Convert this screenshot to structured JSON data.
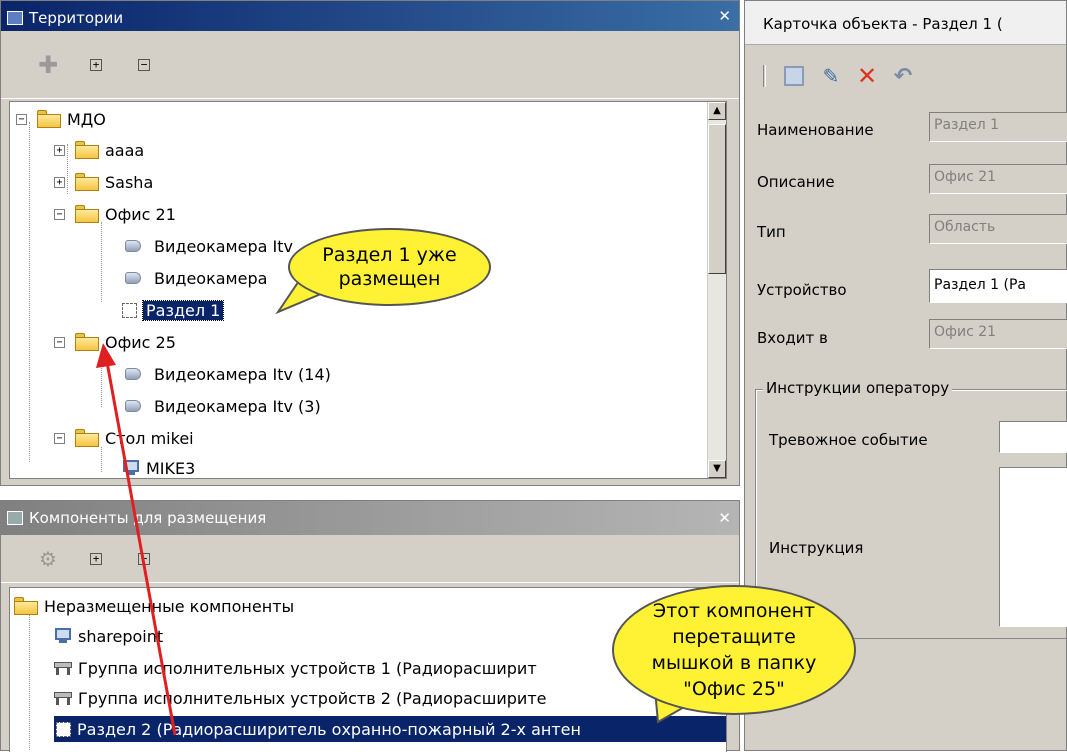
{
  "territories": {
    "title": "Территории",
    "tree": [
      {
        "label": "МДО"
      },
      {
        "label": "aaaa"
      },
      {
        "label": "Sasha"
      },
      {
        "label": "Офис 21"
      },
      {
        "label": "Видеокамера Itv"
      },
      {
        "label": "Видеокамера"
      },
      {
        "label": "Раздел 1"
      },
      {
        "label": "Офис 25"
      },
      {
        "label": "Видеокамера Itv (14)"
      },
      {
        "label": "Видеокамера Itv (3)"
      },
      {
        "label": "Стол mikei"
      },
      {
        "label": "MIKE3"
      }
    ]
  },
  "components": {
    "title": "Компоненты для размещения",
    "tree": [
      {
        "label": "Неразмещенные компоненты"
      },
      {
        "label": "sharepoint"
      },
      {
        "label": "Группа исполнительных устройств 1 (Радиорасширит"
      },
      {
        "label": "Группа исполнительных устройств 2 (Радиорасширите"
      },
      {
        "label": "Раздел 2 (Радиорасширитель охранно-пожарный 2-х антен"
      }
    ]
  },
  "card": {
    "title": "Карточка объекта - Раздел 1 (",
    "fields": [
      {
        "label": "Наименование",
        "value": "Раздел 1"
      },
      {
        "label": "Описание",
        "value": "Офис 21"
      },
      {
        "label": "Тип",
        "value": "Область"
      },
      {
        "label": "Устройство",
        "value": "Раздел 1 (Ра"
      },
      {
        "label": "Входит в",
        "value": "Офис 21"
      }
    ],
    "group_title": "Инструкции оператору",
    "alarm_label": "Тревожное событие",
    "instruction_label": "Инструкция"
  },
  "callouts": {
    "top": "Раздел 1 уже размещен",
    "bottom": "Этот компонент перетащите мышкой в папку \"Офис 25\""
  },
  "colors": {
    "callout": "#fff235",
    "arrow": "#e02020",
    "selection": "#0a246a"
  }
}
